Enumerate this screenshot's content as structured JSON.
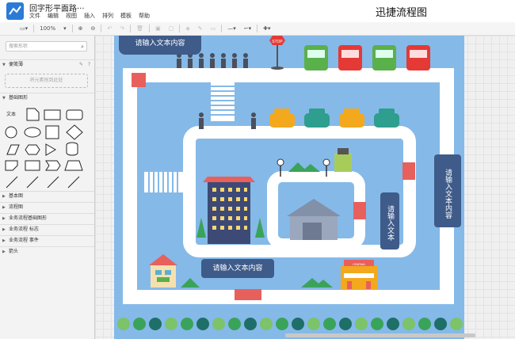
{
  "app": {
    "doc_title": "回字形平面路···",
    "brand": "迅捷流程图",
    "menu": [
      "文件",
      "编辑",
      "视图",
      "插入",
      "排列",
      "模板",
      "帮助"
    ]
  },
  "toolbar": {
    "zoom": "100%"
  },
  "sidebar": {
    "search_placeholder": "搜索形状",
    "scratchpad_label": "便笺薄",
    "scratchpad_drop_hint": "将元素拖到此处",
    "basic_label": "基础图形",
    "text_shape_label": "文本",
    "sections": [
      "基本图",
      "流程图",
      "业务流程基础图形",
      "业务流程 标志",
      "业务流程 事件",
      "箭头"
    ]
  },
  "canvas": {
    "callout_top": "请输入文本内容",
    "callout_center": "请输入文本内容",
    "callout_right_vertical": "请输入文本内容",
    "callout_middle_vertical": "请输入文本",
    "stop_sign": "STOP",
    "building_sign": "CINEMA"
  },
  "colors": {
    "map_bg": "#85b9e8",
    "road": "#ffffff",
    "callout": "#3e5b8a",
    "accent_red": "#e8605c",
    "brand_blue": "#2b7bd6"
  }
}
